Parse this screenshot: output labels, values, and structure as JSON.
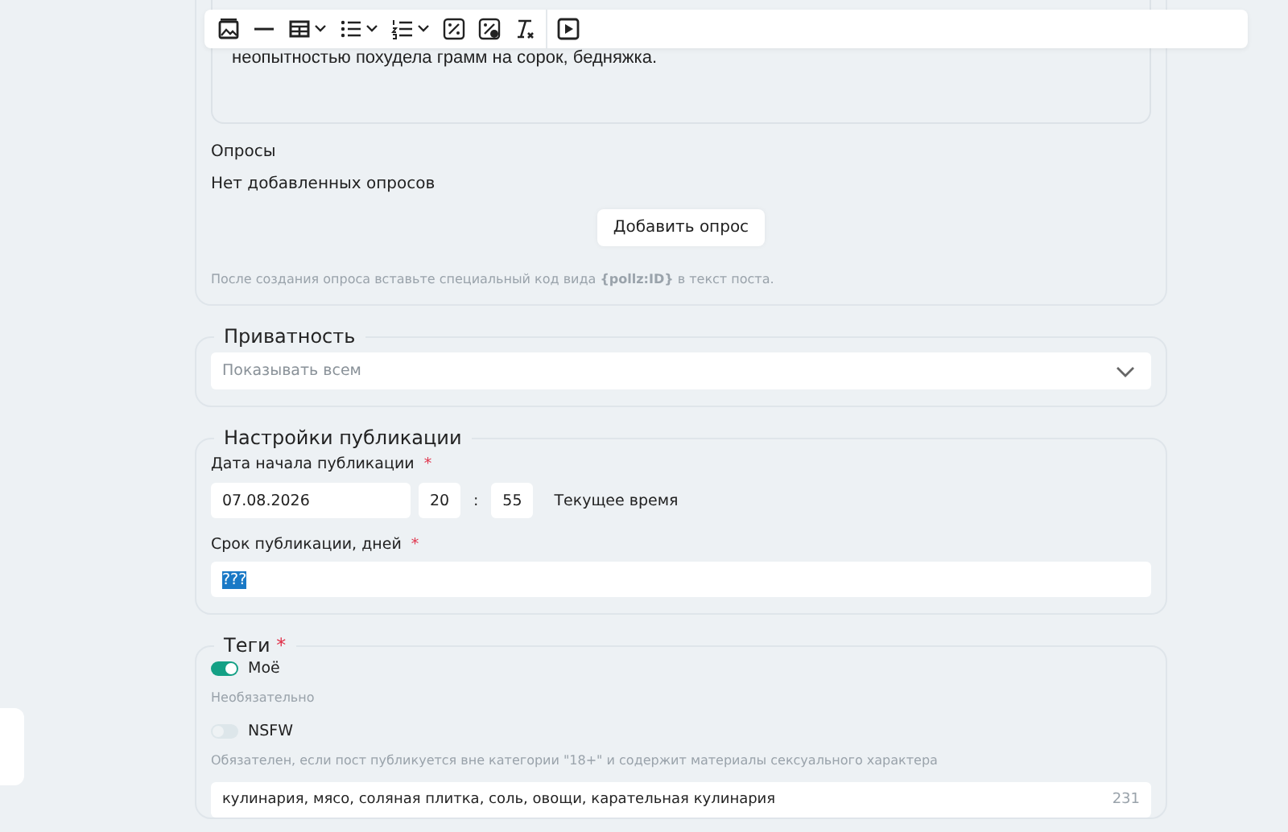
{
  "editor": {
    "toolbar": [
      {
        "kind": "image",
        "caret": false
      },
      {
        "kind": "rule",
        "caret": false
      },
      {
        "kind": "table",
        "caret": true
      },
      {
        "kind": "bullets",
        "caret": true
      },
      {
        "kind": "numbers",
        "caret": true
      },
      {
        "kind": "percent",
        "caret": false
      },
      {
        "kind": "image-percent",
        "caret": false
      },
      {
        "kind": "clear",
        "caret": false
      },
      {
        "kind": "video",
        "caret": false
      }
    ],
    "text": "неопытностью похудела грамм на сорок, бедняжка."
  },
  "polls": {
    "title": "Опросы",
    "empty": "Нет добавленных опросов",
    "button": "Добавить опрос",
    "hint": "После создания опроса вставьте специальный код вида **{pollz:ID}** в текст поста."
  },
  "privacy": {
    "legend": "Приватность",
    "select": {
      "placeholder": "Показывать всем"
    }
  },
  "publication": {
    "legend": "Настройки публикации",
    "start": {
      "label": "Дата начала публикации",
      "mark": "*",
      "date": "07.08.2026",
      "hour": "20",
      "separator": ":",
      "minute": "55",
      "now_link": "Текущее время"
    },
    "term": {
      "label": "Срок публикации, дней",
      "mark": "*",
      "value": "???",
      "selected": true
    }
  },
  "tags": {
    "legend": "Теги",
    "mark": "*",
    "toggles": [
      {
        "label": "Моё",
        "on": true,
        "disabled": false,
        "hint": "Необязательно"
      },
      {
        "label": "NSFW",
        "on": false,
        "disabled": true,
        "hint": "Обязателен, если пост публикуется вне категории \"18+\" и содержит материалы сексуального характера"
      }
    ],
    "input": {
      "value": "кулинария, мясо, соляная плитка, соль, овощи, карательная кулинария",
      "count": "231"
    }
  }
}
